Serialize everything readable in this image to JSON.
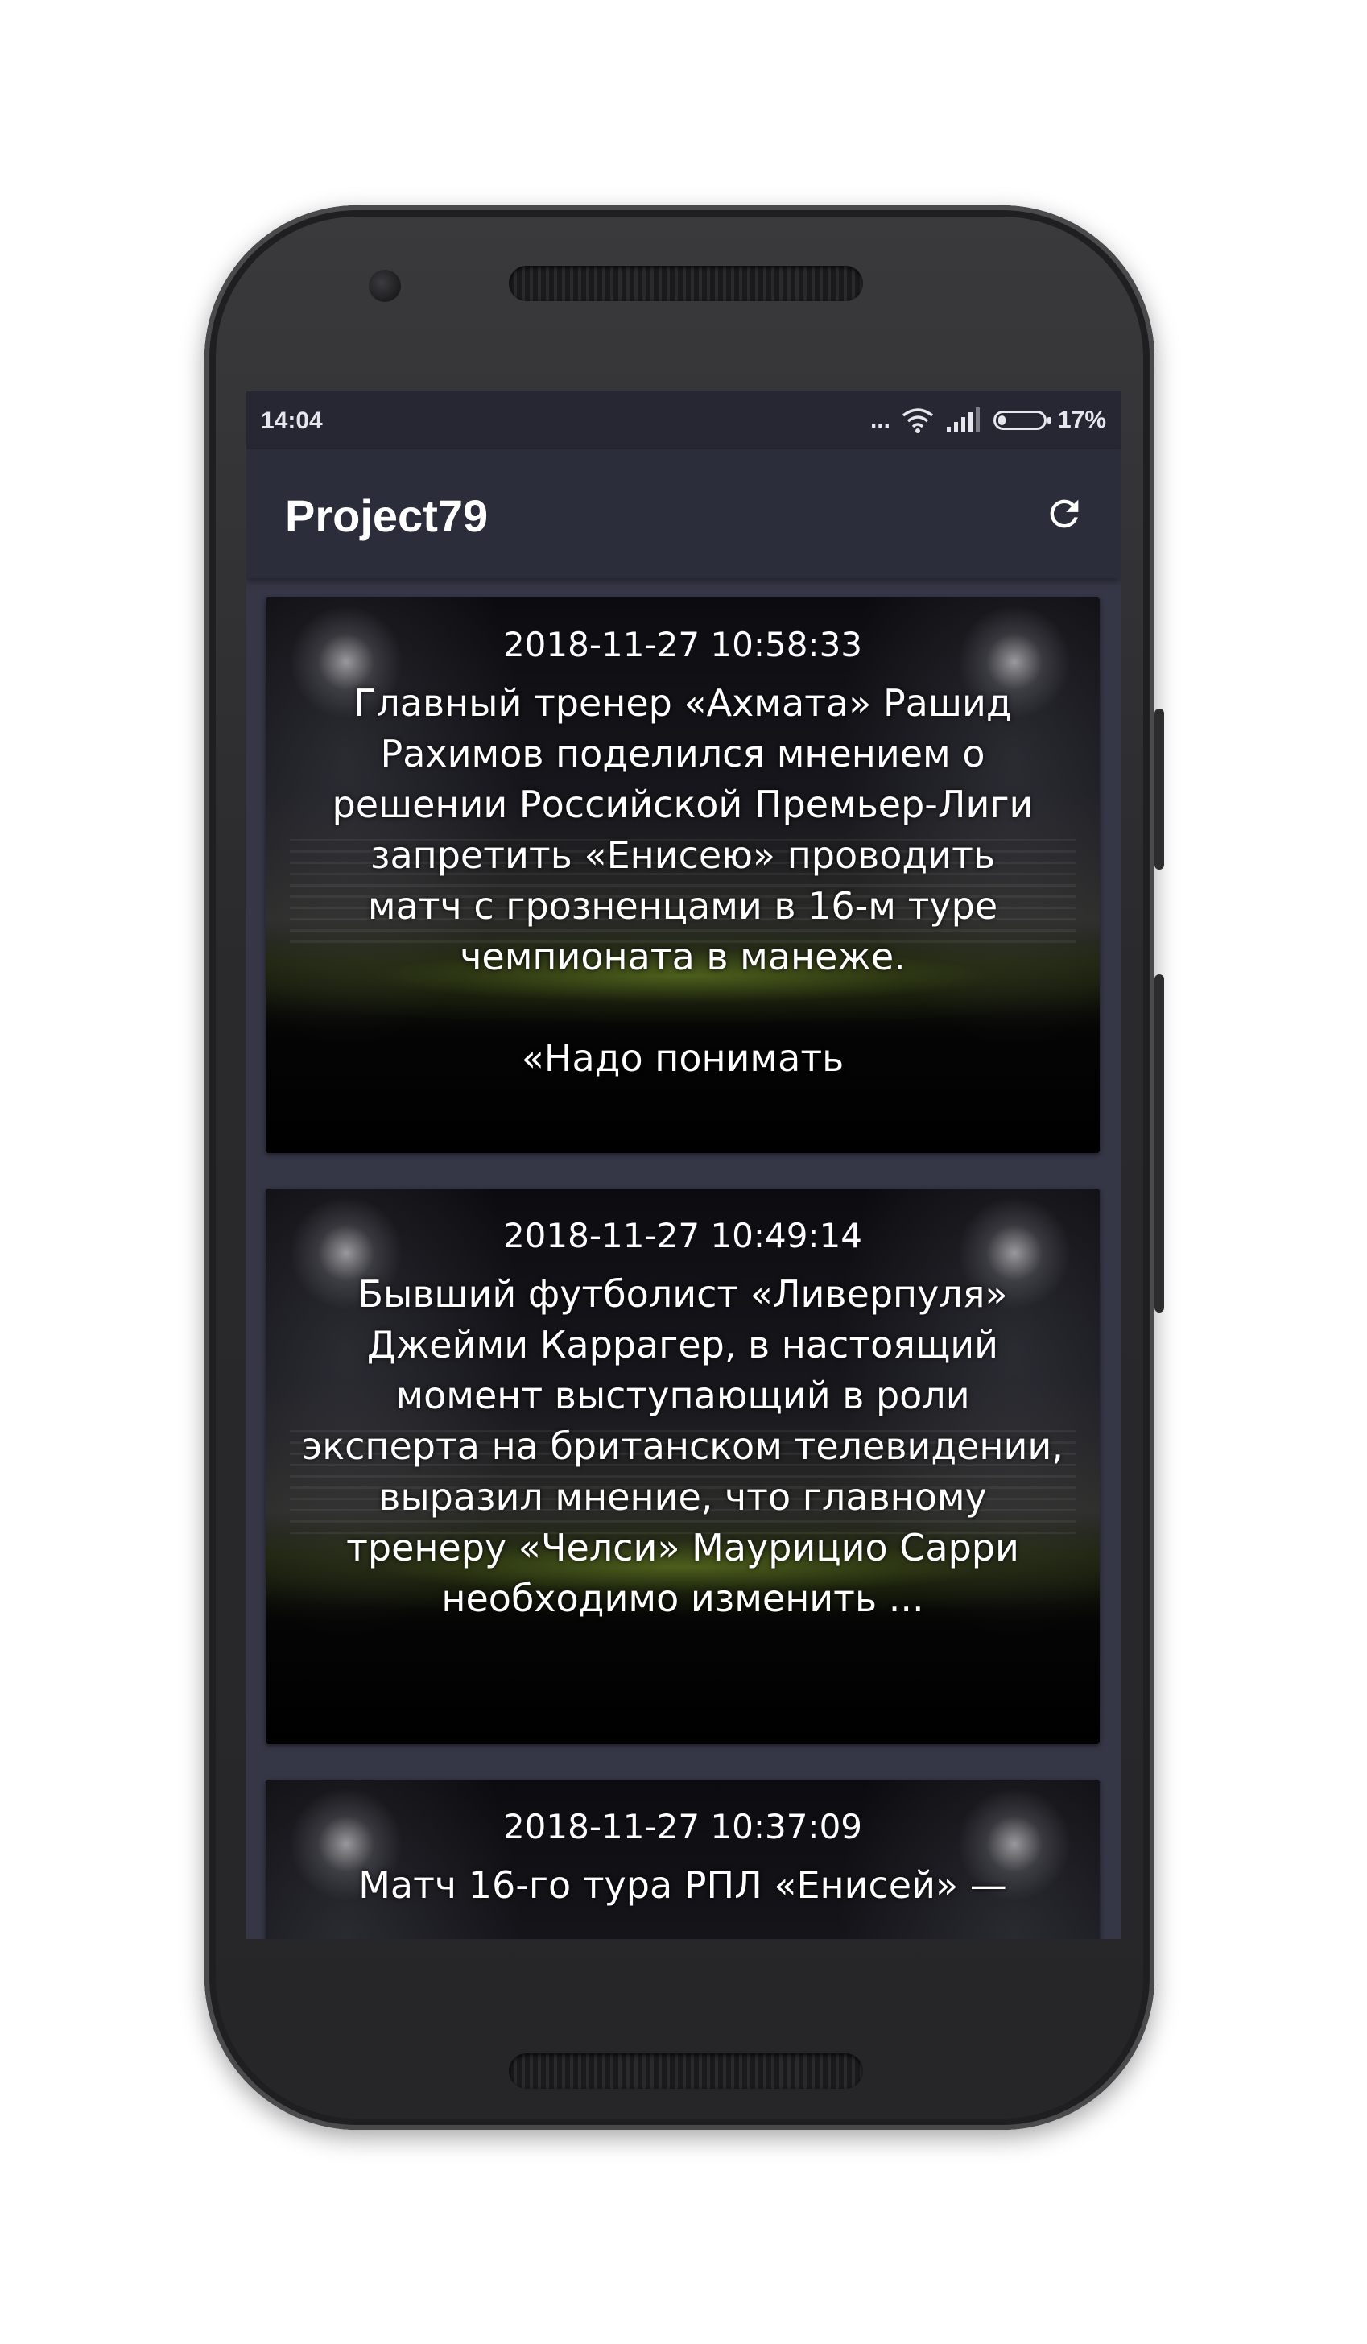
{
  "status_bar": {
    "time": "14:04",
    "dots": "...",
    "battery_percent": "17%",
    "battery_level": 0.17
  },
  "app_bar": {
    "title": "Project79",
    "refresh_icon": "refresh-icon"
  },
  "feed": {
    "items": [
      {
        "date": "2018-11-27 10:58:33",
        "text": "Главный тренер «Ахмата» Рашид\nРахимов поделился мнением о\nрешении Российской Премьер-Лиги\nзапретить «Енисею» проводить\nматч с грозненцами в 16-м туре\nчемпионата в манеже.\n\n«Надо понимать"
      },
      {
        "date": "2018-11-27 10:49:14",
        "text": "Бывший футболист «Ливерпуля»\nДжейми Каррагер, в настоящий\nмомент выступающий в роли\nэксперта на британском телевидении,\nвыразил мнение, что главному\nтренеру «Челси» Маурицио Сарри\nнеобходимо изменить ..."
      },
      {
        "date": "2018-11-27 10:37:09",
        "text": "Матч 16-го тура РПЛ «Енисей» —"
      }
    ]
  }
}
